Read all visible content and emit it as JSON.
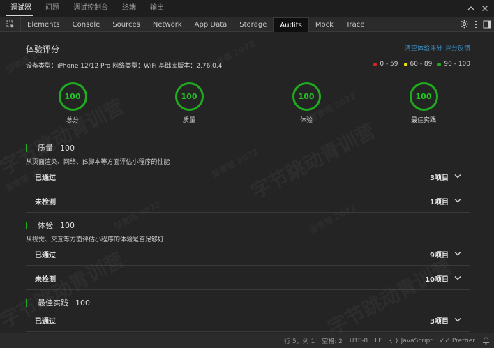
{
  "panelbar": {
    "tabs": [
      "调试器",
      "问题",
      "调试控制台",
      "终端",
      "输出"
    ],
    "active_index": 0
  },
  "tabbar": {
    "tabs": [
      "Elements",
      "Console",
      "Sources",
      "Network",
      "App Data",
      "Storage",
      "Audits",
      "Mock",
      "Trace"
    ],
    "active_index": 6
  },
  "header": {
    "title": "体验评分",
    "link_clear": "清空体验评分",
    "link_feedback": "评分反馈",
    "device_info": "设备类型：iPhone 12/12 Pro 网络类型：WiFi 基础库版本：2.76.0.4"
  },
  "legend": [
    {
      "label": "0 - 59",
      "color": "#e02020"
    },
    {
      "label": "60 - 89",
      "color": "#f2e600"
    },
    {
      "label": "90 - 100",
      "color": "#1faa1f"
    }
  ],
  "scores": [
    {
      "value": "100",
      "label": "总分"
    },
    {
      "value": "100",
      "label": "质量"
    },
    {
      "value": "100",
      "label": "体验"
    },
    {
      "value": "100",
      "label": "最佳实践"
    }
  ],
  "sections": [
    {
      "name": "质量",
      "score": "100",
      "desc": "从页面渲染、网络、JS脚本等方面评估小程序的性能",
      "rows": [
        {
          "label": "已通过",
          "count": "3项目"
        },
        {
          "label": "未检测",
          "count": "1项目"
        }
      ]
    },
    {
      "name": "体验",
      "score": "100",
      "desc": "从视觉、交互等方面评估小程序的体验是否足够好",
      "rows": [
        {
          "label": "已通过",
          "count": "9项目"
        },
        {
          "label": "未检测",
          "count": "10项目"
        }
      ]
    },
    {
      "name": "最佳实践",
      "score": "100",
      "desc": "",
      "rows": [
        {
          "label": "已通过",
          "count": "3项目"
        }
      ]
    }
  ],
  "statusbar": {
    "position": "行 5，列 1",
    "indent": "空格: 2",
    "encoding": "UTF-8",
    "eol": "LF",
    "language": "JavaScript",
    "formatter": "Prettier"
  },
  "watermark": {
    "small": "邹青瑶 2072",
    "large": "字节跳动青训营"
  },
  "colors": {
    "accent_link": "#3c9ad8",
    "score_green": "#1faa1f",
    "background": "#242424"
  }
}
